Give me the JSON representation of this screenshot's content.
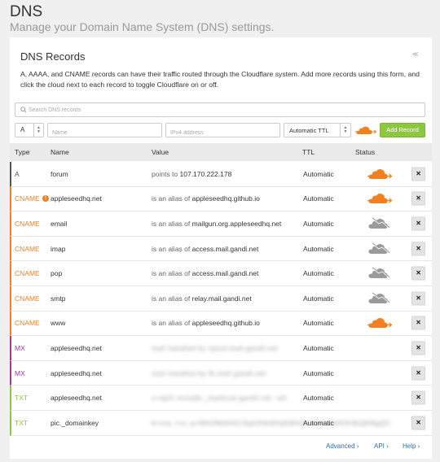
{
  "header": {
    "title": "DNS",
    "subtitle": "Manage your Domain Name System (DNS) settings."
  },
  "card": {
    "title": "DNS Records",
    "description": "A, AAAA, and CNAME records can have their traffic routed through the Cloudflare system. Add more records using this form, and click the cloud next to each record to toggle Cloudflare on or off.",
    "collapse_icon": "collapse-icon"
  },
  "search": {
    "placeholder": "Search DNS records"
  },
  "add_form": {
    "type_value": "A",
    "name_placeholder": "Name",
    "value_placeholder": "IPv4 address",
    "ttl_value": "Automatic TTL",
    "button_label": "Add Record",
    "proxy_icon": "orange-cloud-icon"
  },
  "table": {
    "headers": {
      "type": "Type",
      "name": "Name",
      "value": "Value",
      "ttl": "TTL",
      "status": "Status"
    },
    "rows": [
      {
        "type": "A",
        "type_color": "#555555",
        "name": "forum",
        "prefix": "points to",
        "value": "107.170.222.178",
        "ttl": "Automatic",
        "status": "proxied",
        "info": false,
        "blurred": false,
        "delete": "×"
      },
      {
        "type": "CNAME",
        "type_color": "#f38020",
        "name": "appleseedhq.net",
        "prefix": "is an alias of",
        "value": "appleseedhq.github.io",
        "ttl": "Automatic",
        "status": "proxied",
        "info": true,
        "blurred": false,
        "delete": "×"
      },
      {
        "type": "CNAME",
        "type_color": "#f38020",
        "name": "email",
        "prefix": "is an alias of",
        "value": "mailgun.org.appleseedhq.net",
        "ttl": "Automatic",
        "status": "dns-only",
        "info": false,
        "blurred": false,
        "delete": "×"
      },
      {
        "type": "CNAME",
        "type_color": "#f38020",
        "name": "imap",
        "prefix": "is an alias of",
        "value": "access.mail.gandi.net",
        "ttl": "Automatic",
        "status": "dns-only",
        "info": false,
        "blurred": false,
        "delete": "×"
      },
      {
        "type": "CNAME",
        "type_color": "#f38020",
        "name": "pop",
        "prefix": "is an alias of",
        "value": "access.mail.gandi.net",
        "ttl": "Automatic",
        "status": "dns-only",
        "info": false,
        "blurred": false,
        "delete": "×"
      },
      {
        "type": "CNAME",
        "type_color": "#f38020",
        "name": "smtp",
        "prefix": "is an alias of",
        "value": "relay.mail.gandi.net",
        "ttl": "Automatic",
        "status": "dns-only",
        "info": false,
        "blurred": false,
        "delete": "×"
      },
      {
        "type": "CNAME",
        "type_color": "#f38020",
        "name": "www",
        "prefix": "is an alias of",
        "value": "appleseedhq.github.io",
        "ttl": "Automatic",
        "status": "proxied",
        "info": false,
        "blurred": false,
        "delete": "×"
      },
      {
        "type": "MX",
        "type_color": "#9b3a9b",
        "name": "appleseedhq.net",
        "prefix": "",
        "value": "mail handled by spool.mail.gandi.net",
        "ttl": "Automatic",
        "status": "none",
        "info": false,
        "blurred": true,
        "delete": "×"
      },
      {
        "type": "MX",
        "type_color": "#9b3a9b",
        "name": "appleseedhq.net",
        "prefix": "",
        "value": "mail handled by fb.mail.gandi.net",
        "ttl": "Automatic",
        "status": "none",
        "info": false,
        "blurred": true,
        "delete": "×"
      },
      {
        "type": "TXT",
        "type_color": "#8dc63f",
        "name": "appleseedhq.net",
        "prefix": "",
        "value": "v=spf1 include:_mailcust.gandi.net ~all",
        "ttl": "Automatic",
        "status": "none",
        "info": false,
        "blurred": true,
        "delete": "×"
      },
      {
        "type": "TXT",
        "type_color": "#8dc63f",
        "name": "pic._domainkey",
        "prefix": "",
        "value": "k=rsa; t=s; p=MIGfMA0GCSqGSIb3DQEBAQUAA4GNADCBiQKBgQC",
        "ttl": "Automatic",
        "status": "none",
        "info": false,
        "blurred": true,
        "delete": "×"
      }
    ]
  },
  "footer": {
    "advanced": "Advanced ›",
    "api": "API ›",
    "help": "Help ›"
  },
  "colors": {
    "accent_orange": "#f38020",
    "add_button_green": "#8dc63f",
    "dns_only_grey": "#9a9a9a",
    "link_blue": "#2e6da4"
  }
}
